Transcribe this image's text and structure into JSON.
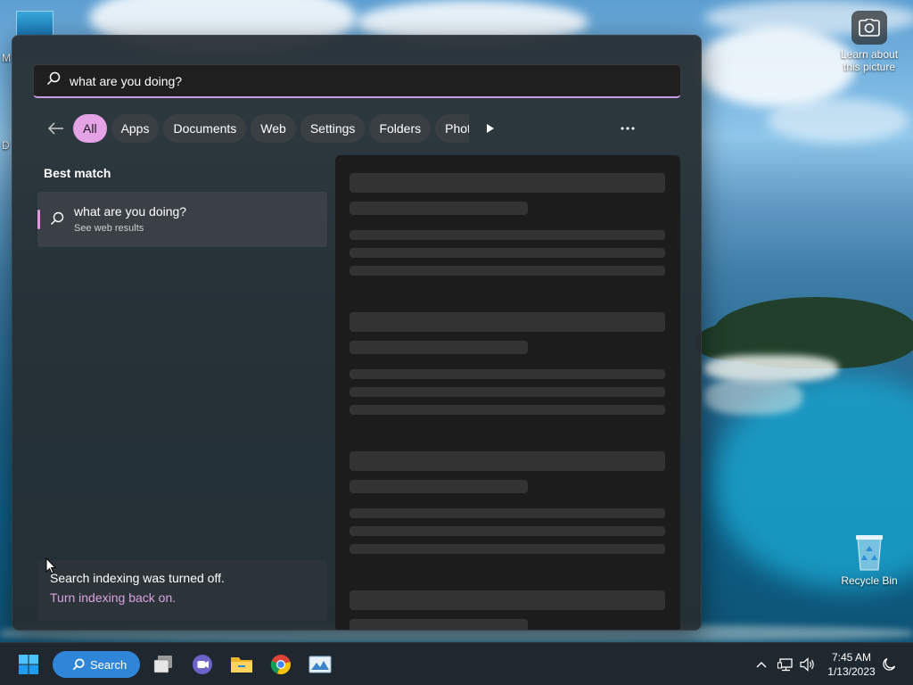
{
  "desktop": {
    "spotlight_label": "Learn about this picture",
    "recycle_bin_label": "Recycle Bin",
    "edge_letter_1": "M",
    "edge_letter_2": "D"
  },
  "search": {
    "query": "what are you doing?",
    "filters": [
      {
        "label": "All",
        "active": true
      },
      {
        "label": "Apps"
      },
      {
        "label": "Documents"
      },
      {
        "label": "Web"
      },
      {
        "label": "Settings"
      },
      {
        "label": "Folders"
      },
      {
        "label": "Phot"
      }
    ],
    "best_match_label": "Best match",
    "best_match": {
      "title": "what are you doing?",
      "subtitle": "See web results"
    },
    "indexing": {
      "message": "Search indexing was turned off.",
      "link": "Turn indexing back on."
    }
  },
  "taskbar": {
    "search_label": "Search",
    "time": "7:45 AM",
    "date": "1/13/2023"
  },
  "colors": {
    "accent": "#e3a3e5",
    "taskbar_search": "#2f86d9"
  }
}
